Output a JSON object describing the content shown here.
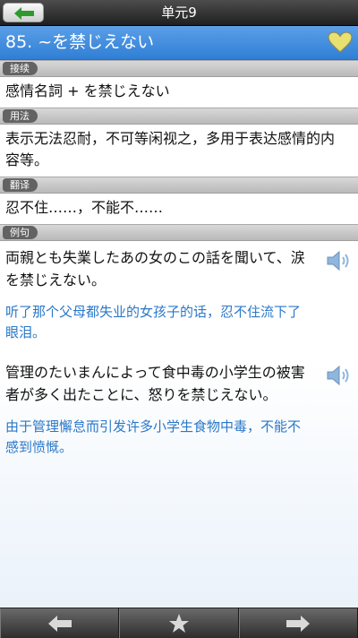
{
  "app": {
    "title": "单元9"
  },
  "entry": {
    "title": "85. ~を禁じえない"
  },
  "sections": {
    "connection": {
      "label": "接续",
      "text": "感情名詞 + を禁じえない"
    },
    "usage": {
      "label": "用法",
      "text": "表示无法忍耐，不可等闲视之，多用于表达感情的内容等。"
    },
    "translation": {
      "label": "翻译",
      "text": "忍不住……，不能不……"
    },
    "examples": {
      "label": "例句",
      "items": [
        {
          "jp": "両親とも失業したあの女のこの話を聞いて、涙を禁じえない。",
          "cn": "听了那个父母都失业的女孩子的话，忍不住流下了眼泪。"
        },
        {
          "jp": "管理のたいまんによって食中毒の小学生の被害者が多く出たことに、怒りを禁じえない。",
          "cn": "由于管理懈怠而引发许多小学生食物中毒，不能不感到愤慨。"
        }
      ]
    }
  },
  "icons": {
    "back": "left-arrow-icon",
    "favorite": "heart-icon",
    "speaker": "speaker-icon",
    "prev": "left-arrow-icon",
    "star": "star-icon",
    "next": "right-arrow-icon"
  },
  "colors": {
    "accent": "#2f7fd6",
    "translation_text": "#2a78c8",
    "favorite": "#e8e070"
  }
}
